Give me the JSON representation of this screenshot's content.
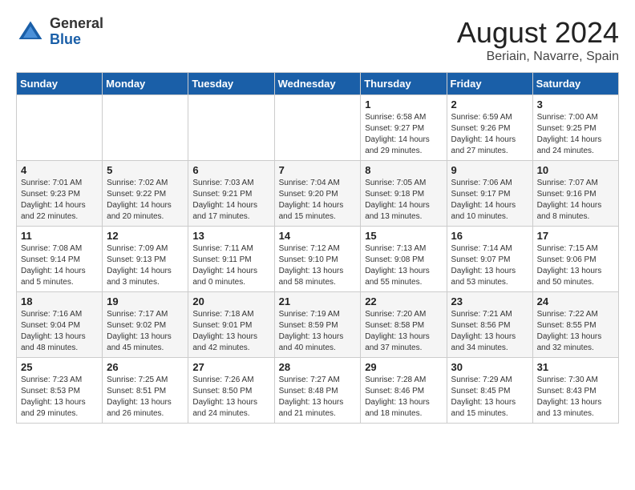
{
  "header": {
    "logo_general": "General",
    "logo_blue": "Blue",
    "month_year": "August 2024",
    "location": "Beriain, Navarre, Spain"
  },
  "days_of_week": [
    "Sunday",
    "Monday",
    "Tuesday",
    "Wednesday",
    "Thursday",
    "Friday",
    "Saturday"
  ],
  "weeks": [
    [
      {
        "day": "",
        "info": ""
      },
      {
        "day": "",
        "info": ""
      },
      {
        "day": "",
        "info": ""
      },
      {
        "day": "",
        "info": ""
      },
      {
        "day": "1",
        "info": "Sunrise: 6:58 AM\nSunset: 9:27 PM\nDaylight: 14 hours\nand 29 minutes."
      },
      {
        "day": "2",
        "info": "Sunrise: 6:59 AM\nSunset: 9:26 PM\nDaylight: 14 hours\nand 27 minutes."
      },
      {
        "day": "3",
        "info": "Sunrise: 7:00 AM\nSunset: 9:25 PM\nDaylight: 14 hours\nand 24 minutes."
      }
    ],
    [
      {
        "day": "4",
        "info": "Sunrise: 7:01 AM\nSunset: 9:23 PM\nDaylight: 14 hours\nand 22 minutes."
      },
      {
        "day": "5",
        "info": "Sunrise: 7:02 AM\nSunset: 9:22 PM\nDaylight: 14 hours\nand 20 minutes."
      },
      {
        "day": "6",
        "info": "Sunrise: 7:03 AM\nSunset: 9:21 PM\nDaylight: 14 hours\nand 17 minutes."
      },
      {
        "day": "7",
        "info": "Sunrise: 7:04 AM\nSunset: 9:20 PM\nDaylight: 14 hours\nand 15 minutes."
      },
      {
        "day": "8",
        "info": "Sunrise: 7:05 AM\nSunset: 9:18 PM\nDaylight: 14 hours\nand 13 minutes."
      },
      {
        "day": "9",
        "info": "Sunrise: 7:06 AM\nSunset: 9:17 PM\nDaylight: 14 hours\nand 10 minutes."
      },
      {
        "day": "10",
        "info": "Sunrise: 7:07 AM\nSunset: 9:16 PM\nDaylight: 14 hours\nand 8 minutes."
      }
    ],
    [
      {
        "day": "11",
        "info": "Sunrise: 7:08 AM\nSunset: 9:14 PM\nDaylight: 14 hours\nand 5 minutes."
      },
      {
        "day": "12",
        "info": "Sunrise: 7:09 AM\nSunset: 9:13 PM\nDaylight: 14 hours\nand 3 minutes."
      },
      {
        "day": "13",
        "info": "Sunrise: 7:11 AM\nSunset: 9:11 PM\nDaylight: 14 hours\nand 0 minutes."
      },
      {
        "day": "14",
        "info": "Sunrise: 7:12 AM\nSunset: 9:10 PM\nDaylight: 13 hours\nand 58 minutes."
      },
      {
        "day": "15",
        "info": "Sunrise: 7:13 AM\nSunset: 9:08 PM\nDaylight: 13 hours\nand 55 minutes."
      },
      {
        "day": "16",
        "info": "Sunrise: 7:14 AM\nSunset: 9:07 PM\nDaylight: 13 hours\nand 53 minutes."
      },
      {
        "day": "17",
        "info": "Sunrise: 7:15 AM\nSunset: 9:06 PM\nDaylight: 13 hours\nand 50 minutes."
      }
    ],
    [
      {
        "day": "18",
        "info": "Sunrise: 7:16 AM\nSunset: 9:04 PM\nDaylight: 13 hours\nand 48 minutes."
      },
      {
        "day": "19",
        "info": "Sunrise: 7:17 AM\nSunset: 9:02 PM\nDaylight: 13 hours\nand 45 minutes."
      },
      {
        "day": "20",
        "info": "Sunrise: 7:18 AM\nSunset: 9:01 PM\nDaylight: 13 hours\nand 42 minutes."
      },
      {
        "day": "21",
        "info": "Sunrise: 7:19 AM\nSunset: 8:59 PM\nDaylight: 13 hours\nand 40 minutes."
      },
      {
        "day": "22",
        "info": "Sunrise: 7:20 AM\nSunset: 8:58 PM\nDaylight: 13 hours\nand 37 minutes."
      },
      {
        "day": "23",
        "info": "Sunrise: 7:21 AM\nSunset: 8:56 PM\nDaylight: 13 hours\nand 34 minutes."
      },
      {
        "day": "24",
        "info": "Sunrise: 7:22 AM\nSunset: 8:55 PM\nDaylight: 13 hours\nand 32 minutes."
      }
    ],
    [
      {
        "day": "25",
        "info": "Sunrise: 7:23 AM\nSunset: 8:53 PM\nDaylight: 13 hours\nand 29 minutes."
      },
      {
        "day": "26",
        "info": "Sunrise: 7:25 AM\nSunset: 8:51 PM\nDaylight: 13 hours\nand 26 minutes."
      },
      {
        "day": "27",
        "info": "Sunrise: 7:26 AM\nSunset: 8:50 PM\nDaylight: 13 hours\nand 24 minutes."
      },
      {
        "day": "28",
        "info": "Sunrise: 7:27 AM\nSunset: 8:48 PM\nDaylight: 13 hours\nand 21 minutes."
      },
      {
        "day": "29",
        "info": "Sunrise: 7:28 AM\nSunset: 8:46 PM\nDaylight: 13 hours\nand 18 minutes."
      },
      {
        "day": "30",
        "info": "Sunrise: 7:29 AM\nSunset: 8:45 PM\nDaylight: 13 hours\nand 15 minutes."
      },
      {
        "day": "31",
        "info": "Sunrise: 7:30 AM\nSunset: 8:43 PM\nDaylight: 13 hours\nand 13 minutes."
      }
    ]
  ]
}
